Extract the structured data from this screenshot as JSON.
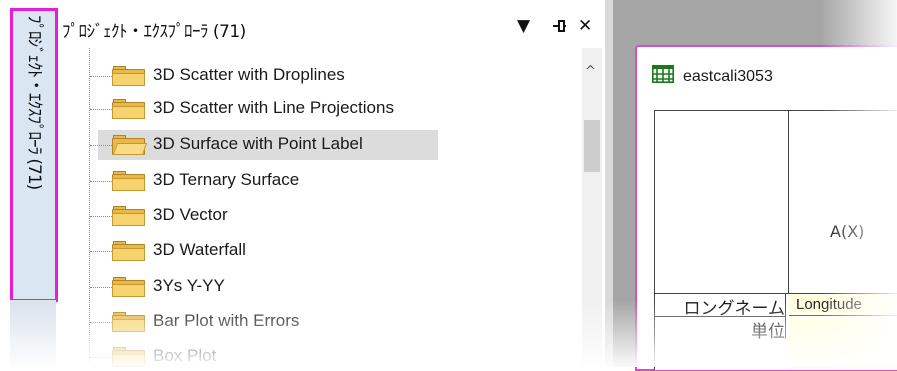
{
  "side_tab": {
    "label": "ﾌﾟﾛｼﾞｪｸﾄ・ｴｸｽﾌﾟﾛｰﾗ (71)",
    "highlight_color": "#e61fd6"
  },
  "explorer": {
    "title": "ﾌﾟﾛｼﾞｪｸﾄ・ｴｸｽﾌﾟﾛｰﾗ (71)",
    "dropdown_glyph": "▼",
    "pin_glyph": "⊣",
    "close_glyph": "✕",
    "items": [
      {
        "label": "3D Scatter with Droplines",
        "selected": false
      },
      {
        "label": "3D Scatter with Line Projections",
        "selected": false
      },
      {
        "label": "3D Surface with Point Label",
        "selected": true
      },
      {
        "label": "3D Ternary Surface",
        "selected": false
      },
      {
        "label": "3D Vector",
        "selected": false
      },
      {
        "label": "3D Waterfall",
        "selected": false
      },
      {
        "label": "3Ys Y-YY",
        "selected": false
      },
      {
        "label": "Bar Plot with Errors",
        "selected": false
      },
      {
        "label": "Box Plot",
        "selected": false
      }
    ],
    "scroll_up_glyph": "^"
  },
  "workbook": {
    "title": "eastcali3053",
    "title_icon": "grid-icon",
    "border_color": "#d44fc7",
    "column_a_label": "A(X)",
    "row_longname_label": "ロングネーム",
    "row_unit_label": "単位",
    "cell_longname_value": "Longitude"
  }
}
